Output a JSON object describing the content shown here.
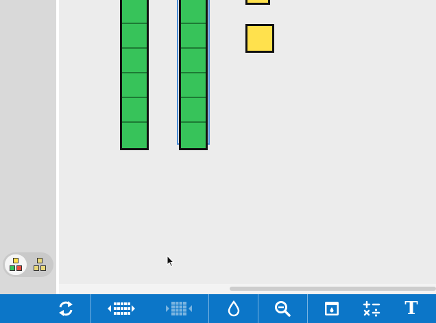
{
  "workspace": {
    "rods": [
      {
        "name": "ten-rod-1",
        "cells": 10,
        "selected": false
      },
      {
        "name": "ten-rod-2",
        "cells": 10,
        "selected": true
      }
    ],
    "unit_cubes": [
      {
        "name": "unit-cube-1"
      },
      {
        "name": "unit-cube-2"
      }
    ],
    "colors": {
      "rod_fill": "#37c35a",
      "cube_fill": "#ffe14d",
      "selection": "#4a8bd6"
    }
  },
  "palette": {
    "options": [
      "colored-cubes-icon",
      "yellow-cubes-icon"
    ]
  },
  "toolbar": {
    "background": "#0c76c8",
    "buttons": [
      {
        "name": "refresh-icon"
      },
      {
        "name": "group-cubes-icon"
      },
      {
        "name": "ungroup-cubes-icon"
      },
      {
        "name": "color-drop-icon"
      },
      {
        "name": "zoom-out-icon"
      },
      {
        "name": "show-hide-icon"
      },
      {
        "name": "operations-icon"
      },
      {
        "name": "text-tool-icon",
        "label": "T"
      }
    ]
  }
}
